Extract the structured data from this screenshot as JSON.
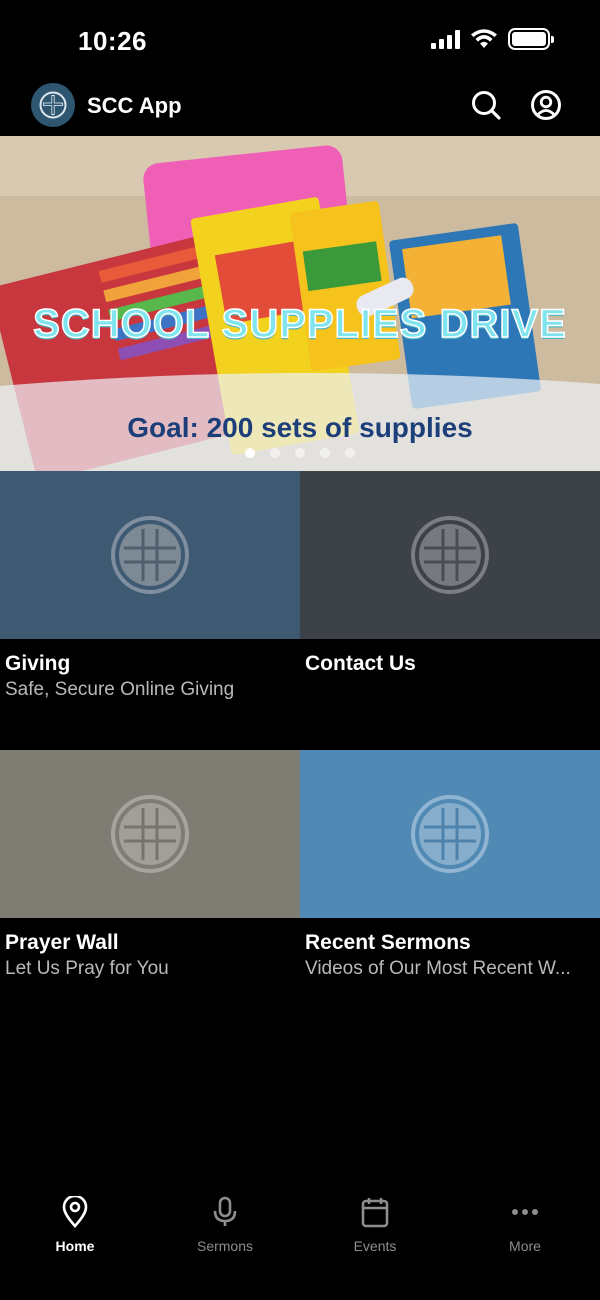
{
  "status_bar": {
    "time": "10:26",
    "battery_level": 1.0
  },
  "header": {
    "title": "SCC App",
    "logo_icon": "cross-logo-icon",
    "search_icon": "search-icon",
    "profile_icon": "profile-icon"
  },
  "banner": {
    "title": "SCHOOL SUPPLIES DRIVE",
    "goal": "Goal: 200 sets of supplies",
    "slide_count": 5,
    "active_slide": 1
  },
  "tiles": [
    {
      "title": "Giving",
      "subtitle": "Safe, Secure Online Giving",
      "color": "#3e5a72"
    },
    {
      "title": "Contact Us",
      "subtitle": "",
      "color": "#3d4248"
    },
    {
      "title": "Prayer Wall",
      "subtitle": "Let Us Pray for You",
      "color": "#7f7c74"
    },
    {
      "title": "Recent Sermons",
      "subtitle": "Videos of Our Most Recent W...",
      "color": "#5189b5"
    }
  ],
  "nav": {
    "items": [
      {
        "label": "Home",
        "icon": "location-pin-icon",
        "active": true
      },
      {
        "label": "Sermons",
        "icon": "microphone-icon",
        "active": false
      },
      {
        "label": "Events",
        "icon": "calendar-icon",
        "active": false
      },
      {
        "label": "More",
        "icon": "more-dots-icon",
        "active": false
      }
    ]
  },
  "colors": {
    "background": "#000000",
    "accent": "#ffffff",
    "nav_inactive": "#8e8e8e",
    "banner_title": "#7fe4ee",
    "banner_goal": "#1c3f7a"
  }
}
